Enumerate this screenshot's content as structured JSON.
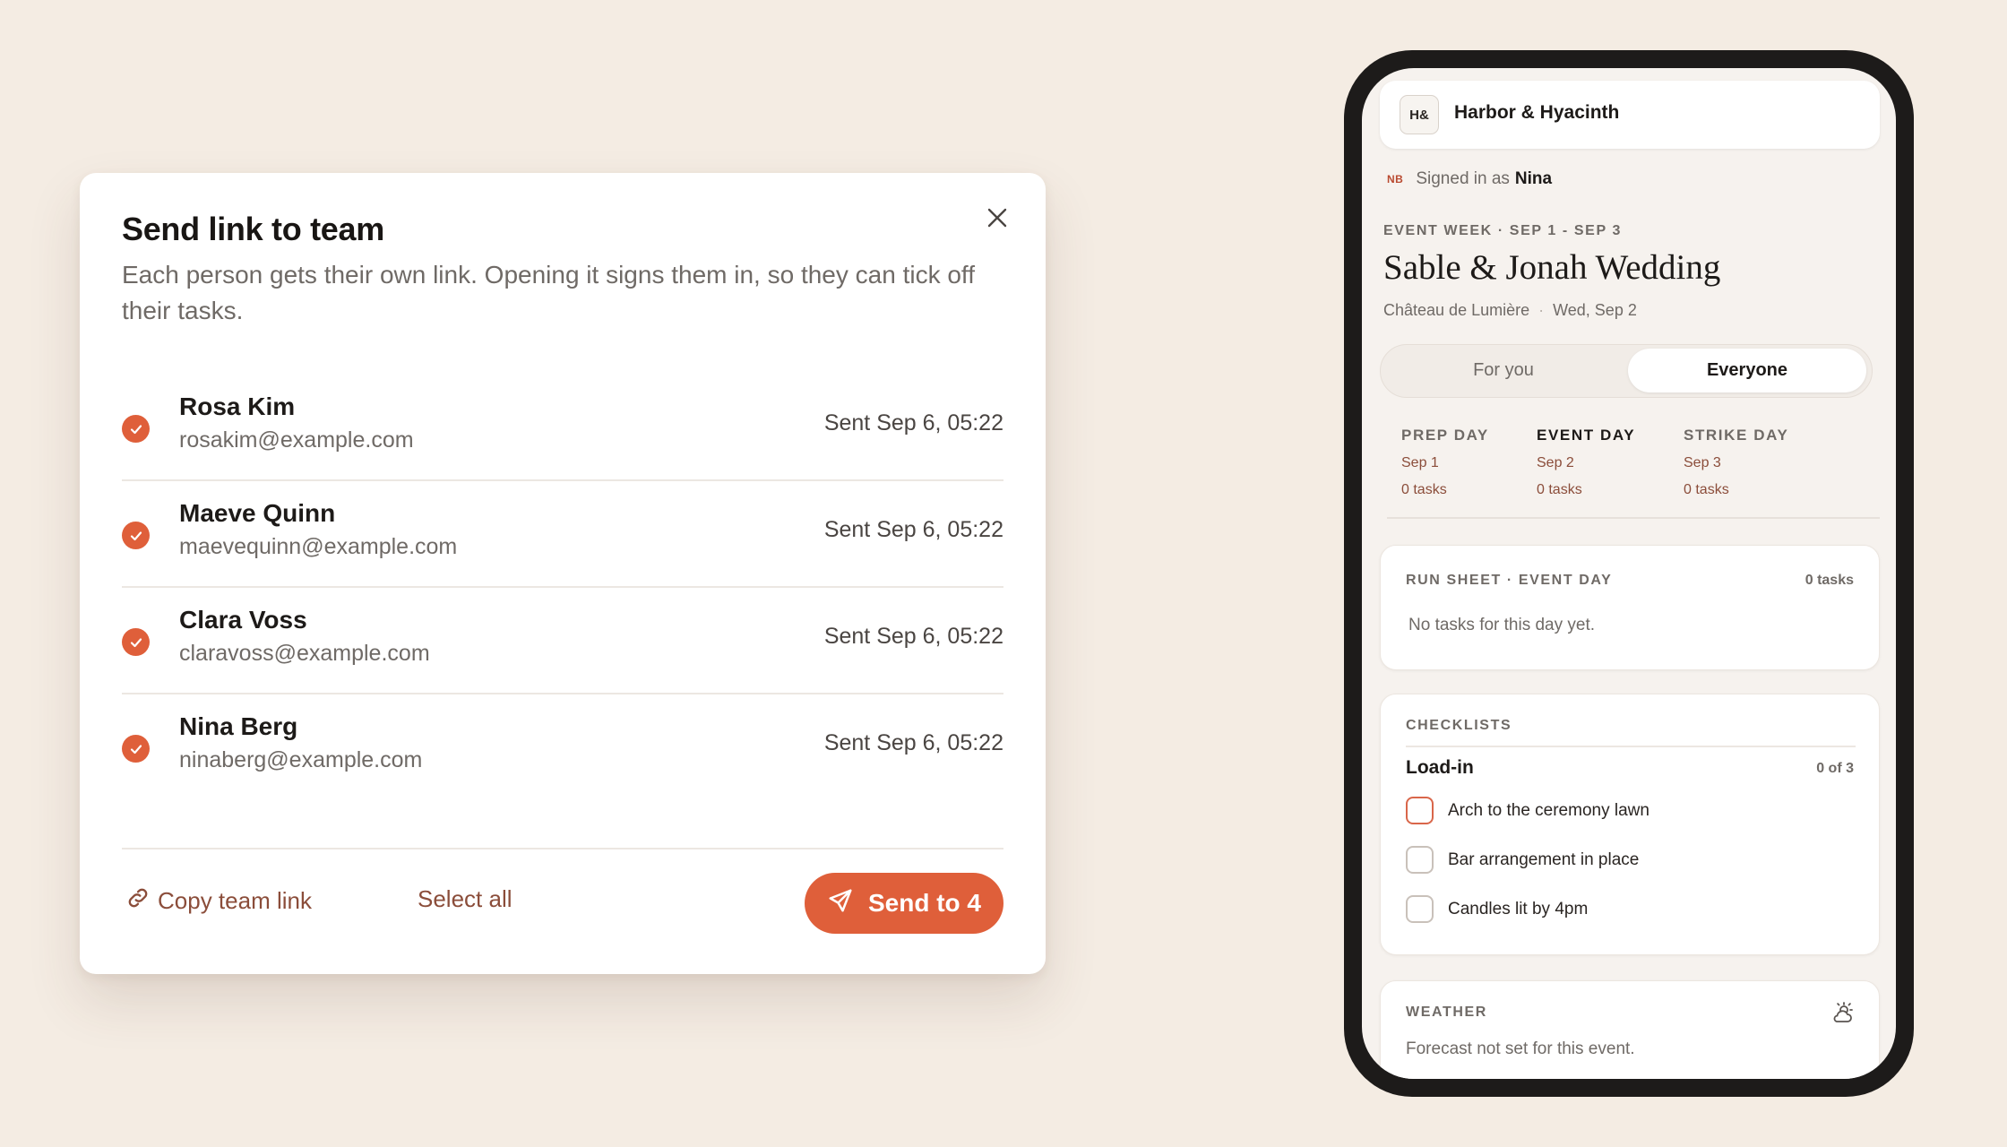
{
  "modal": {
    "title": "Send link to team",
    "subtitle": "Each person gets their own link. Opening it signs them in, so they can tick off their tasks.",
    "people": [
      {
        "name": "Rosa Kim",
        "email": "rosakim@example.com",
        "status": "Sent Sep 6, 05:22",
        "checked": true
      },
      {
        "name": "Maeve Quinn",
        "email": "maevequinn@example.com",
        "status": "Sent Sep 6, 05:22",
        "checked": true
      },
      {
        "name": "Clara Voss",
        "email": "claravoss@example.com",
        "status": "Sent Sep 6, 05:22",
        "checked": true
      },
      {
        "name": "Nina Berg",
        "email": "ninaberg@example.com",
        "status": "Sent Sep 6, 05:22",
        "checked": true
      }
    ],
    "copy_link_label": "Copy team link",
    "select_all_label": "Select all",
    "send_label": "Send to 4"
  },
  "phone": {
    "logo_text": "H&",
    "brand": "Harbor & Hyacinth",
    "initials": "NB",
    "signed_prefix": "Signed in as",
    "signed_name": "Nina",
    "event_week": "EVENT WEEK · SEP 1 - SEP 3",
    "event_title": "Sable & Jonah Wedding",
    "venue": "Château de Lumière",
    "meta_separator": "·",
    "event_date": "Wed, Sep 2",
    "tabs": [
      "For you",
      "Everyone"
    ],
    "active_tab": "Everyone",
    "days": [
      {
        "label": "PREP DAY",
        "date": "Sep 1",
        "tasks": "0 tasks"
      },
      {
        "label": "EVENT DAY",
        "date": "Sep 2",
        "tasks": "0 tasks"
      },
      {
        "label": "STRIKE DAY",
        "date": "Sep 3",
        "tasks": "0 tasks"
      }
    ],
    "active_day": "EVENT DAY",
    "run_sheet": {
      "title": "RUN SHEET · EVENT DAY",
      "count": "0 tasks",
      "empty": "No tasks for this day yet."
    },
    "checklists": {
      "header": "CHECKLISTS",
      "title": "Load-in",
      "progress": "0 of 3",
      "items": [
        "Arch to the ceremony lawn",
        "Bar arrangement in place",
        "Candles lit by 4pm"
      ]
    },
    "weather": {
      "title": "WEATHER",
      "text": "Forecast not set for this event.",
      "icon": "sun-cloud-icon"
    }
  },
  "colors": {
    "accent": "#df5f3a",
    "link": "#8b4d3a",
    "background": "#f4ece3"
  }
}
